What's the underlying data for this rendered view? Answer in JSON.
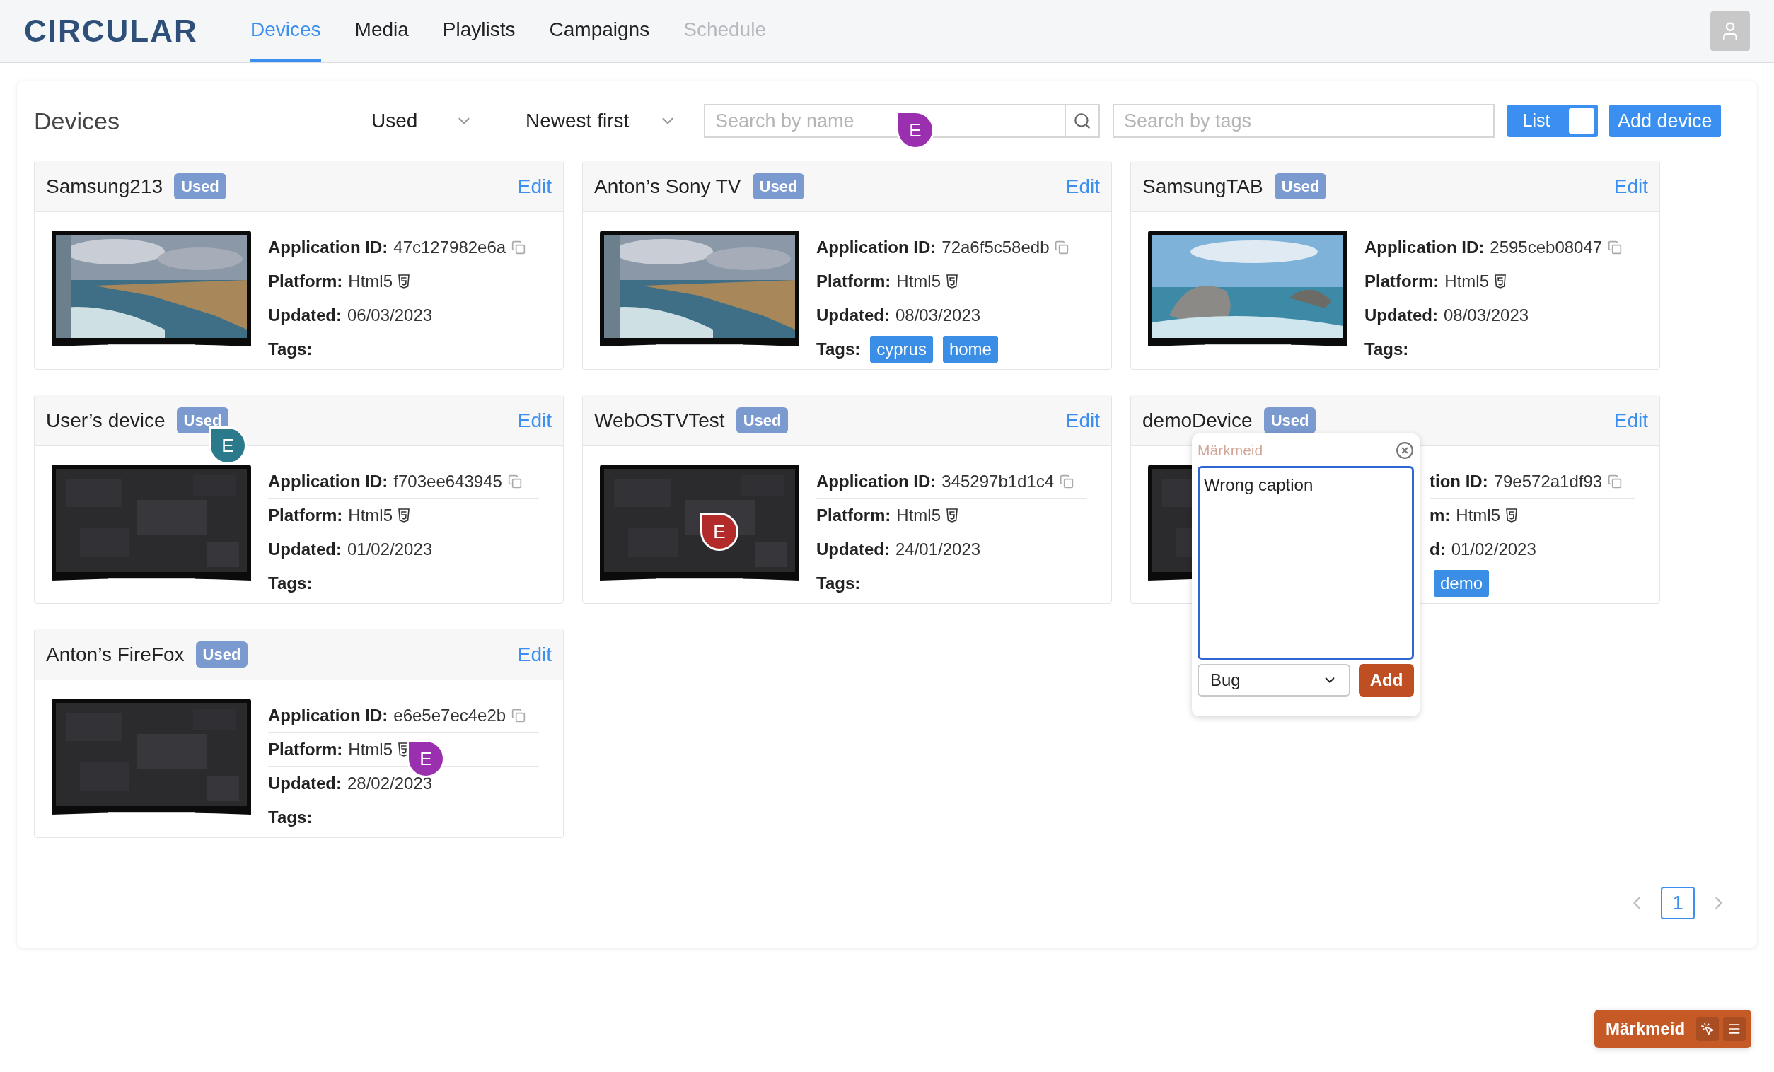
{
  "header": {
    "logo": "CIRCULAR",
    "tabs": [
      {
        "label": "Devices",
        "selected": true,
        "disabled": false
      },
      {
        "label": "Media",
        "selected": false,
        "disabled": false
      },
      {
        "label": "Playlists",
        "selected": false,
        "disabled": false
      },
      {
        "label": "Campaigns",
        "selected": false,
        "disabled": false
      },
      {
        "label": "Schedule",
        "selected": false,
        "disabled": true
      }
    ]
  },
  "toolbar": {
    "title": "Devices",
    "filter": "Used",
    "sort": "Newest first",
    "search_name": {
      "placeholder": "Search by name",
      "marker": {
        "label": "E",
        "color": "#9a2fb0"
      }
    },
    "search_tags": {
      "placeholder": "Search by tags"
    },
    "view_toggle": {
      "label": "List",
      "on": true
    },
    "add_button": "Add device"
  },
  "devices": [
    {
      "name": "Samsung213",
      "status": "Used",
      "edit": "Edit",
      "rows": [
        {
          "kind": "id",
          "label": "Application ID:",
          "value": "47c127982e6a"
        },
        {
          "kind": "platform",
          "label": "Platform:",
          "value": "Html5"
        },
        {
          "kind": "date",
          "label": "Updated:",
          "value": "06/03/2023"
        },
        {
          "kind": "tags",
          "label": "Tags:",
          "tags": []
        }
      ]
    },
    {
      "name": "Anton’s Sony TV",
      "status": "Used",
      "edit": "Edit",
      "rows": [
        {
          "kind": "id",
          "label": "Application ID:",
          "value": "72a6f5c58edb"
        },
        {
          "kind": "platform",
          "label": "Platform:",
          "value": "Html5"
        },
        {
          "kind": "date",
          "label": "Updated:",
          "value": "08/03/2023"
        },
        {
          "kind": "tags",
          "label": "Tags:",
          "tags": [
            "cyprus",
            "home"
          ]
        }
      ]
    },
    {
      "name": "SamsungTAB",
      "status": "Used",
      "edit": "Edit",
      "rows": [
        {
          "kind": "id",
          "label": "Application ID:",
          "value": "2595ceb08047"
        },
        {
          "kind": "platform",
          "label": "Platform:",
          "value": "Html5"
        },
        {
          "kind": "date",
          "label": "Updated:",
          "value": "08/03/2023"
        },
        {
          "kind": "tags",
          "label": "Tags:",
          "tags": []
        }
      ]
    },
    {
      "name": "User’s device",
      "status": "Used",
      "edit": "Edit",
      "marker": {
        "label": "E",
        "color": "#2b7a8c"
      },
      "rows": [
        {
          "kind": "id",
          "label": "Application ID:",
          "value": "f703ee643945"
        },
        {
          "kind": "platform",
          "label": "Platform:",
          "value": "Html5"
        },
        {
          "kind": "date",
          "label": "Updated:",
          "value": "01/02/2023"
        },
        {
          "kind": "tags",
          "label": "Tags:",
          "tags": []
        }
      ]
    },
    {
      "name": "WebOSTVTest",
      "status": "Used",
      "edit": "Edit",
      "marker": {
        "label": "E",
        "color": "#b32a2a"
      },
      "rows": [
        {
          "kind": "id",
          "label": "Application ID:",
          "value": "345297b1d1c4"
        },
        {
          "kind": "platform",
          "label": "Platform:",
          "value": "Html5"
        },
        {
          "kind": "date",
          "label": "Updated:",
          "value": "24/01/2023"
        },
        {
          "kind": "tags",
          "label": "Tags:",
          "tags": []
        }
      ]
    },
    {
      "name": "demoDevice",
      "status": "Used",
      "edit": "Edit",
      "rows": [
        {
          "kind": "id",
          "label": "tion ID:",
          "value": "79e572a1df93"
        },
        {
          "kind": "platform",
          "label": "m:",
          "value": "Html5"
        },
        {
          "kind": "date",
          "label": "d:",
          "value": "01/02/2023"
        },
        {
          "kind": "tags",
          "tags": [
            "demo"
          ]
        }
      ]
    },
    {
      "name": "Anton’s FireFox",
      "status": "Used",
      "edit": "Edit",
      "marker": {
        "label": "E",
        "color": "#9a2fb0"
      },
      "rows": [
        {
          "kind": "id",
          "label": "Application ID:",
          "value": "e6e5e7ec4e2b"
        },
        {
          "kind": "platform",
          "label": "Platform:",
          "value": "Html5"
        },
        {
          "kind": "date",
          "label": "Updated:",
          "value": "28/02/2023"
        },
        {
          "kind": "tags",
          "label": "Tags:",
          "tags": []
        }
      ]
    }
  ],
  "note_popup": {
    "title": "Märkmeid",
    "text": "Wrong caption",
    "category": "Bug",
    "add_button": "Add"
  },
  "pagination": {
    "pages": [
      {
        "label": "1",
        "selected": true
      }
    ]
  },
  "widget": {
    "label": "Märkmeid"
  }
}
